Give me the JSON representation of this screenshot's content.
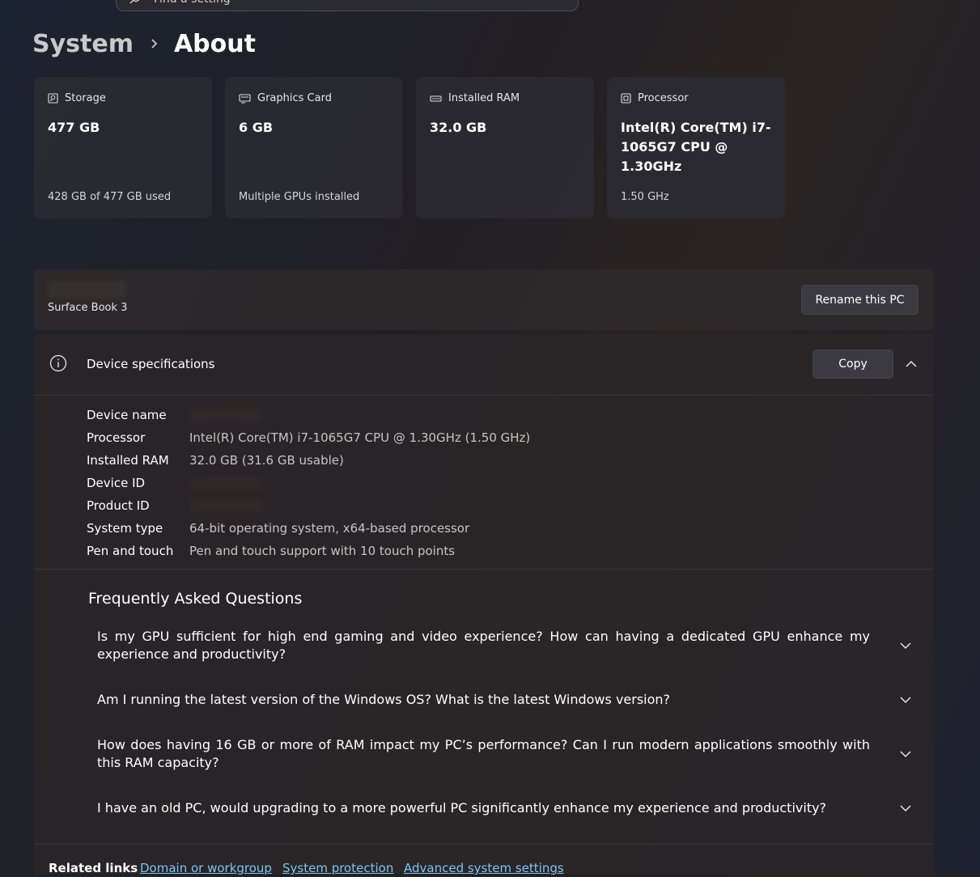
{
  "search": {
    "placeholder": "Find a setting"
  },
  "breadcrumb": {
    "parent": "System",
    "current": "About"
  },
  "cards": [
    {
      "icon": "storage-icon",
      "label": "Storage",
      "value": "477 GB",
      "sub": "428 GB of 477 GB used"
    },
    {
      "icon": "graphics-card-icon",
      "label": "Graphics Card",
      "value": "6 GB",
      "sub": "Multiple GPUs installed"
    },
    {
      "icon": "ram-icon",
      "label": "Installed RAM",
      "value": "32.0 GB",
      "sub": ""
    },
    {
      "icon": "processor-icon",
      "label": "Processor",
      "value": "Intel(R) Core(TM) i7-1065G7 CPU @ 1.30GHz",
      "sub": "1.50 GHz"
    }
  ],
  "device": {
    "model": "Surface Book 3",
    "rename_label": "Rename this PC"
  },
  "specs": {
    "title": "Device specifications",
    "copy_label": "Copy",
    "rows": [
      {
        "label": "Device name",
        "value": ""
      },
      {
        "label": "Processor",
        "value": "Intel(R) Core(TM) i7-1065G7 CPU @ 1.30GHz (1.50 GHz)"
      },
      {
        "label": "Installed RAM",
        "value": "32.0 GB (31.6 GB usable)"
      },
      {
        "label": "Device ID",
        "value": ""
      },
      {
        "label": "Product ID",
        "value": ""
      },
      {
        "label": "System type",
        "value": "64-bit operating system, x64-based processor"
      },
      {
        "label": "Pen and touch",
        "value": "Pen and touch support with 10 touch points"
      }
    ]
  },
  "faq": {
    "title": "Frequently Asked Questions",
    "items": [
      "Is my GPU sufficient for high end gaming and video experience? How can having a dedicated GPU enhance my experience and productivity?",
      "Am I running the latest version of the Windows OS? What is the latest Windows version?",
      "How does having 16 GB or more of RAM impact my PC’s performance? Can I run modern applications smoothly with this RAM capacity?",
      "I have an old PC, would upgrading to a more powerful PC significantly enhance my experience and productivity?"
    ]
  },
  "related": {
    "label": "Related links",
    "links": [
      "Domain or workgroup",
      "System protection",
      "Advanced system settings"
    ]
  },
  "colors": {
    "accent_link": "#7fc4ef",
    "card_bg": "#2c2c32",
    "text_muted": "#c8c4c2"
  }
}
